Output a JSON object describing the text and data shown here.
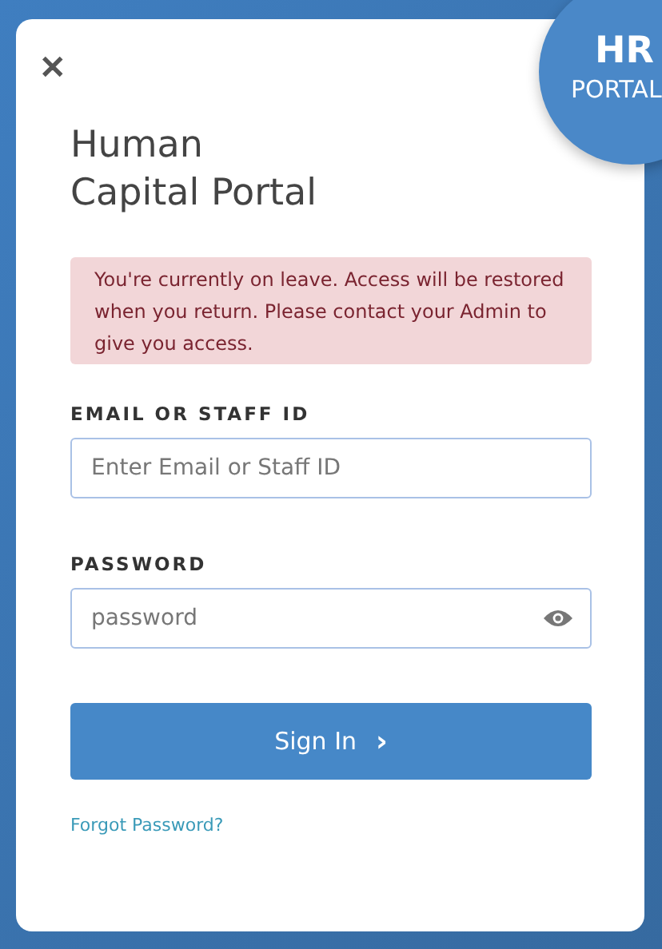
{
  "badge": {
    "title": "HR",
    "subtitle": "PORTAL"
  },
  "close": {
    "label": "✕"
  },
  "heading": [
    "Human",
    "Capital Portal"
  ],
  "alert": {
    "text": "You're currently on leave. Access will be restored when you return. Please contact your Admin to give you access."
  },
  "fields": [
    {
      "kind": "text",
      "label": "EMAIL OR STAFF ID",
      "placeholder": "Enter Email or Staff ID"
    },
    {
      "kind": "password",
      "label": "PASSWORD",
      "placeholder": "password"
    }
  ],
  "submit": {
    "label": "Sign In",
    "icon": "›"
  },
  "forgot_link": "Forgot Password?"
}
